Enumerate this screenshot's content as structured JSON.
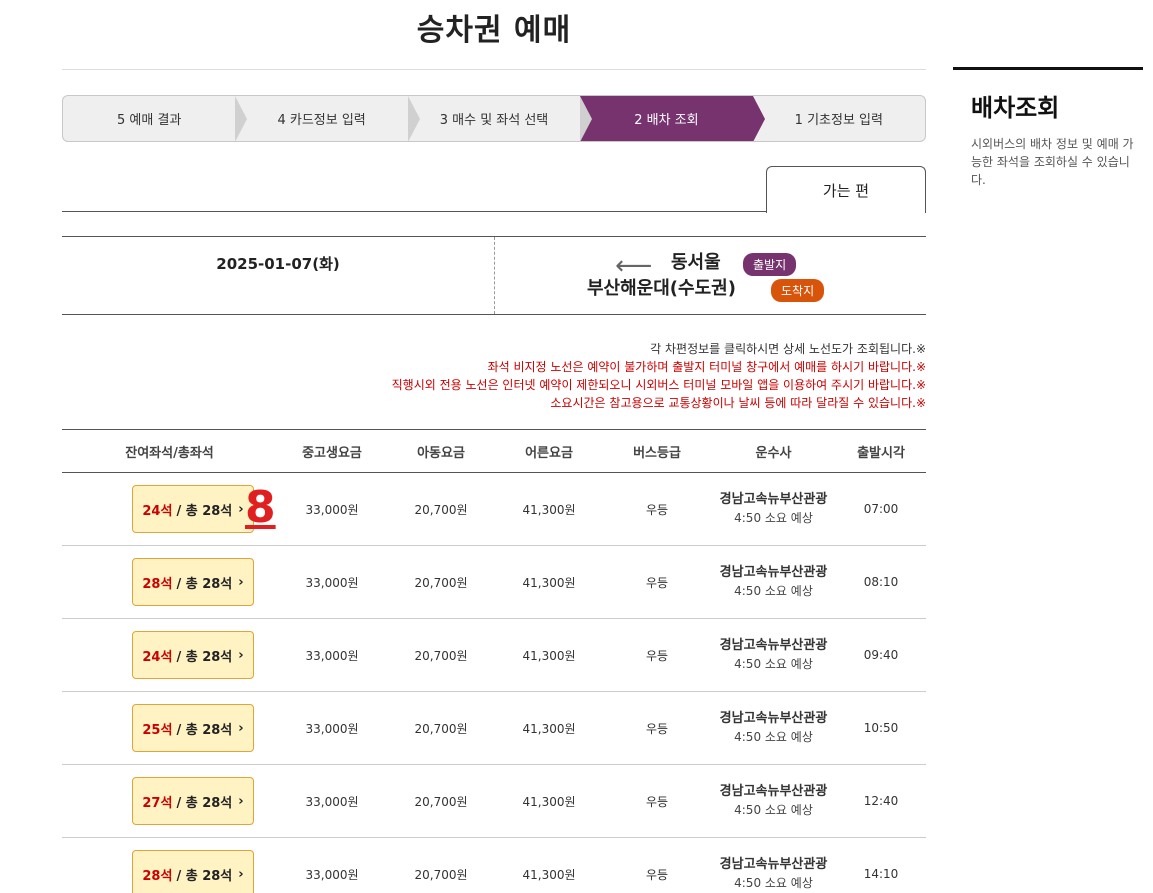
{
  "page": {
    "title": "승차권 예매"
  },
  "side": {
    "title": "배차조회",
    "desc": "시외버스의 배차 정보 및 예매 가능한 좌석을 조회하실 수 있습니다."
  },
  "steps": [
    {
      "label": "5 예매 결과"
    },
    {
      "label": "4 카드정보 입력"
    },
    {
      "label": "3 매수 및 좌석 선택"
    },
    {
      "label": "2 배차 조회",
      "active": true
    },
    {
      "label": "1 기초정보 입력"
    }
  ],
  "tab": {
    "label": "가는 편"
  },
  "route": {
    "date": "2025-01-07(화)",
    "dep_badge": "출발지",
    "dep_place": "동서울",
    "arr_badge": "도착지",
    "arr_place": "부산해운대(수도권)",
    "arrow": "⟵"
  },
  "notices": [
    {
      "prefix": "※",
      "text": "각 차편정보를 클릭하시면 상세 노선도가 조회됩니다."
    },
    {
      "prefix": "※",
      "text": "좌석 비지정 노선은 예약이 불가하며 출발지 터미널 창구에서 예매를 하시기 바랍니다."
    },
    {
      "prefix": "※",
      "text": "직행시외 전용 노선은 인터넷 예약이 제한되오니 시외버스 터미널 모바일 앱을 이용하여 주시기 바랍니다."
    },
    {
      "prefix": "※",
      "text": "소요시간은 참고용으로 교통상황이나 날씨 등에 따라 달라질 수 있습니다."
    }
  ],
  "table": {
    "headers": {
      "seat": "잔여좌석/총좌석",
      "mid": "중고생요금",
      "child": "아동요금",
      "adult": "어른요금",
      "grade": "버스등급",
      "company": "운수사",
      "time": "출발시각"
    },
    "rows": [
      {
        "seat_left": "24석",
        "seat_total": "/ 총 28석",
        "mid": "33,000원",
        "child": "20,700원",
        "adult": "41,300원",
        "grade": "우등",
        "company": "경남고속뉴부산관광",
        "duration": "4:50 소요 예상",
        "time": "07:00"
      },
      {
        "seat_left": "28석",
        "seat_total": "/ 총 28석",
        "mid": "33,000원",
        "child": "20,700원",
        "adult": "41,300원",
        "grade": "우등",
        "company": "경남고속뉴부산관광",
        "duration": "4:50 소요 예상",
        "time": "08:10"
      },
      {
        "seat_left": "24석",
        "seat_total": "/ 총 28석",
        "mid": "33,000원",
        "child": "20,700원",
        "adult": "41,300원",
        "grade": "우등",
        "company": "경남고속뉴부산관광",
        "duration": "4:50 소요 예상",
        "time": "09:40"
      },
      {
        "seat_left": "25석",
        "seat_total": "/ 총 28석",
        "mid": "33,000원",
        "child": "20,700원",
        "adult": "41,300원",
        "grade": "우등",
        "company": "경남고속뉴부산관광",
        "duration": "4:50 소요 예상",
        "time": "10:50"
      },
      {
        "seat_left": "27석",
        "seat_total": "/ 총 28석",
        "mid": "33,000원",
        "child": "20,700원",
        "adult": "41,300원",
        "grade": "우등",
        "company": "경남고속뉴부산관광",
        "duration": "4:50 소요 예상",
        "time": "12:40"
      },
      {
        "seat_left": "28석",
        "seat_total": "/ 총 28석",
        "mid": "33,000원",
        "child": "20,700원",
        "adult": "41,300원",
        "grade": "우등",
        "company": "경남고속뉴부산관광",
        "duration": "4:50 소요 예상",
        "time": "14:10"
      }
    ]
  },
  "annotation": {
    "label": "8"
  }
}
